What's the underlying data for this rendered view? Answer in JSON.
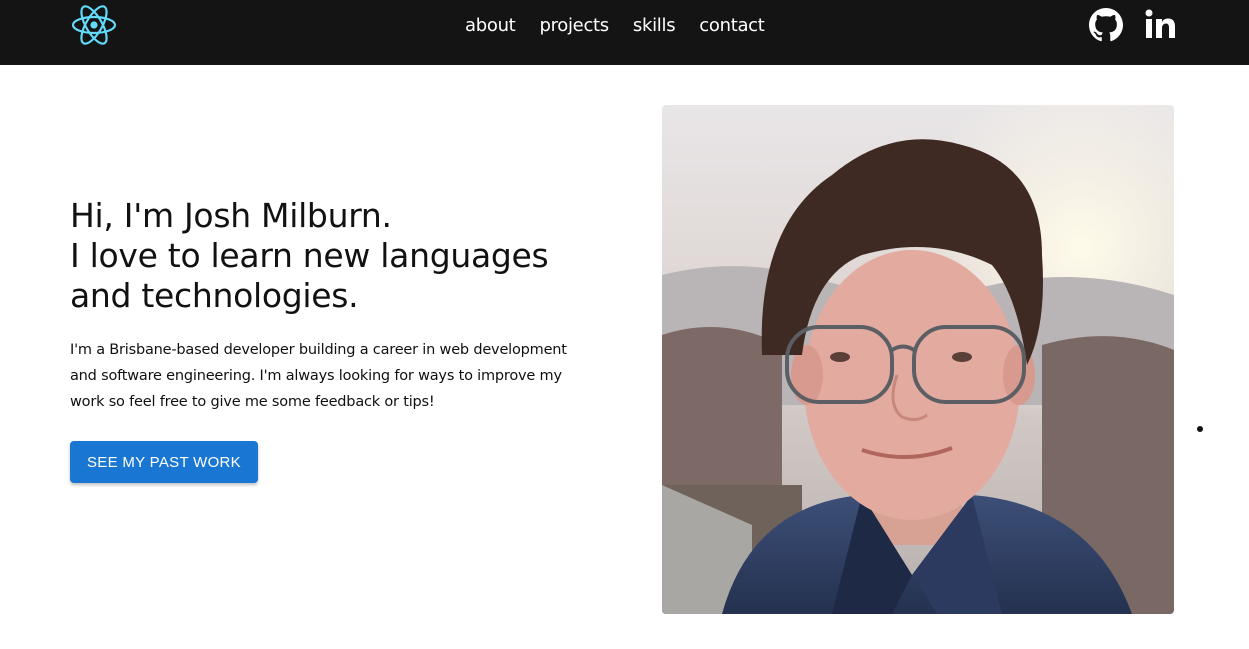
{
  "nav": {
    "links": [
      "about",
      "projects",
      "skills",
      "contact"
    ],
    "logo_icon": "react-atom-icon",
    "social": [
      {
        "name": "github",
        "icon": "github-icon"
      },
      {
        "name": "linkedin",
        "icon": "linkedin-icon"
      }
    ]
  },
  "hero": {
    "headline": [
      "Hi, I'm Josh Milburn.",
      "I love to learn new languages",
      "and technologies."
    ],
    "intro": "I'm a Brisbane-based developer building a career in web development and software engineering. I'm always looking for ways to improve my work so feel free to give me some feedback or tips!",
    "cta_label": "SEE MY PAST WORK"
  },
  "colors": {
    "navbar": "#141414",
    "accent": "#1976d2",
    "logo": "#61dafb"
  }
}
